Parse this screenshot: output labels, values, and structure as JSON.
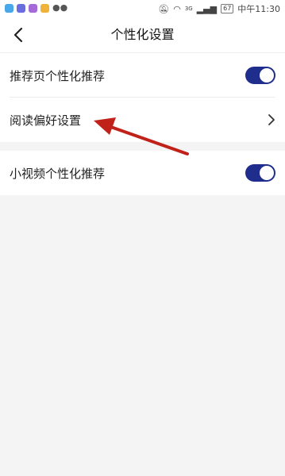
{
  "status_bar": {
    "time": "中午11:30",
    "battery": "67",
    "network": "3G"
  },
  "header": {
    "title": "个性化设置"
  },
  "settings": {
    "recommend_page_label": "推荐页个性化推荐",
    "recommend_page_enabled": true,
    "reading_pref_label": "阅读偏好设置",
    "short_video_label": "小视频个性化推荐",
    "short_video_enabled": true
  },
  "colors": {
    "toggle_on": "#1f2e8c",
    "annotation_arrow": "#c0221a"
  }
}
